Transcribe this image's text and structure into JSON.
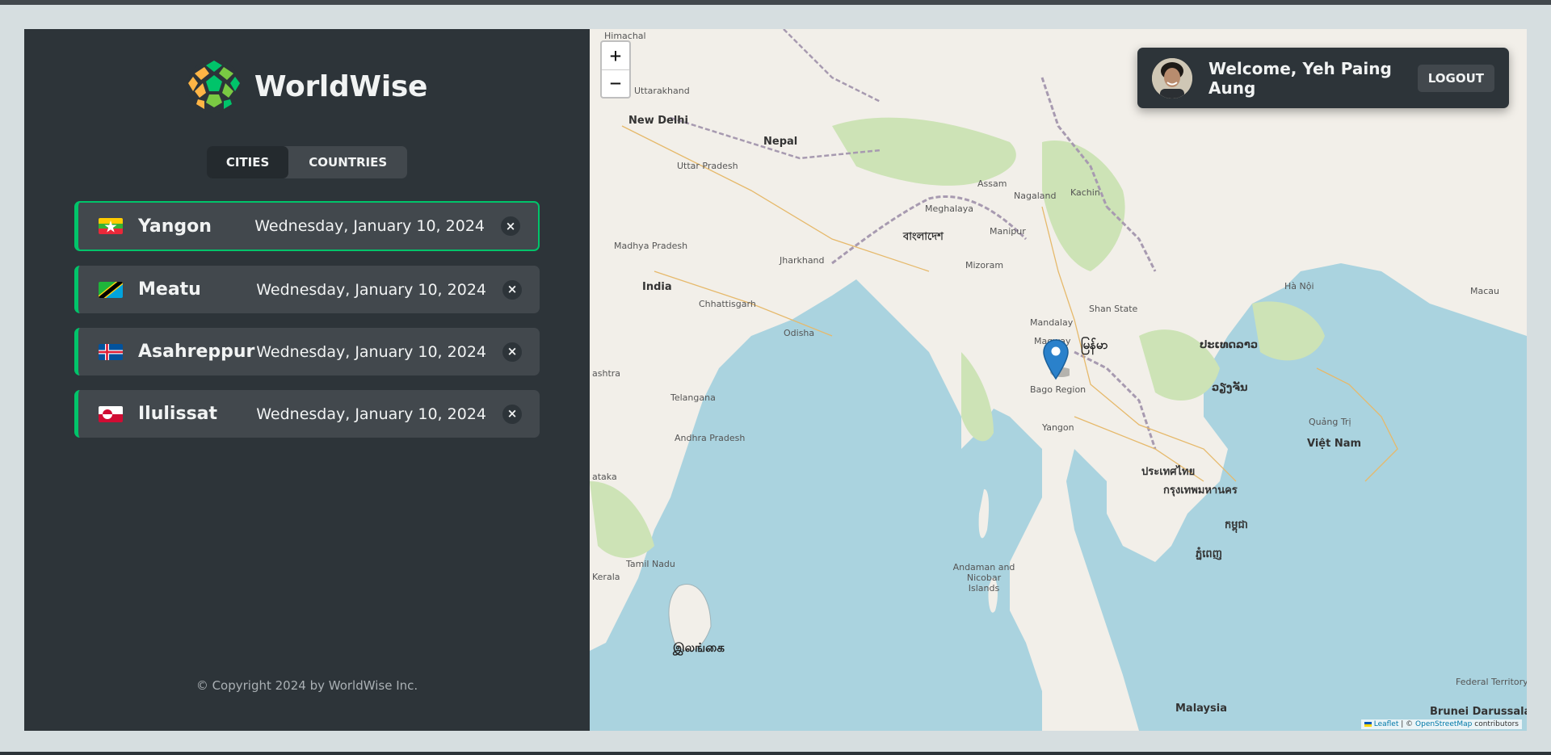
{
  "app": {
    "name": "WorldWise"
  },
  "tabs": [
    {
      "label": "CITIES",
      "active": true
    },
    {
      "label": "COUNTRIES",
      "active": false
    }
  ],
  "cities": [
    {
      "name": "Yangon",
      "date": "Wednesday, January 10, 2024",
      "flag": "myanmar-flag",
      "active": true
    },
    {
      "name": "Meatu",
      "date": "Wednesday, January 10, 2024",
      "flag": "tanzania-flag",
      "active": false
    },
    {
      "name": "Asahreppur",
      "date": "Wednesday, January 10, 2024",
      "flag": "iceland-flag",
      "active": false
    },
    {
      "name": "Ilulissat",
      "date": "Wednesday, January 10, 2024",
      "flag": "greenland-flag",
      "active": false
    }
  ],
  "delete_label": "×",
  "footer": {
    "copyright": "© Copyright 2024 by WorldWise Inc."
  },
  "map": {
    "zoom_in": "+",
    "zoom_out": "−",
    "labels": [
      "Himachal",
      "Uttarakhand",
      "New Delhi",
      "Nepal",
      "Uttar Pradesh",
      "India",
      "Madhya Pradesh",
      "Chhattisgarh",
      "Jharkhand",
      "Odisha",
      "Telangana",
      "Andhra Pradesh",
      "Tamil Nadu",
      "Kerala",
      "ashtra",
      "ataka",
      "বাংলাদেশ",
      "Assam",
      "Meghalaya",
      "Mizoram",
      "Manipur",
      "Nagaland",
      "Kachin",
      "Mandalay",
      "Magway",
      "Shan State",
      "Bago Region",
      "Yangon",
      "မြန်မာ",
      "ประเทศไทย",
      "กรุงเทพมหานคร",
      "ປະເທດລາວ",
      "ວຽງຈັນ",
      "Việt Nam",
      "កម្ពុជា",
      "ភ្នំពេញ",
      "Andaman and Nicobar Islands",
      "இலங்கை",
      "Malaysia",
      "Brunei Darussalam",
      "Federal Territory",
      "Macau",
      "Hà Nội",
      "Quảng Trị"
    ],
    "attribution": {
      "leaflet": "Leaflet",
      "sep": " | © ",
      "osm": "OpenStreetMap",
      "rest": " contributors"
    }
  },
  "user": {
    "welcome": "Welcome, Yeh Paing Aung",
    "logout": "LOGOUT"
  },
  "colors": {
    "brand": "#00c46a",
    "dark0": "#242a2e",
    "dark1": "#2d3439",
    "dark2": "#42484d",
    "light": "#f1f3f3",
    "sea": "#aad3df",
    "land": "#f2efe9",
    "marker": "#2a81cb"
  }
}
